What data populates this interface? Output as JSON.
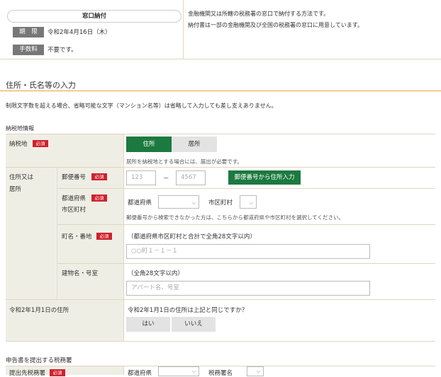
{
  "payment": {
    "method_label": "窓口納付",
    "deadline_tag": "期　限",
    "deadline_value": "令和2年4月16日（木）",
    "fee_tag": "手数料",
    "fee_value": "不要です。",
    "desc_line1": "金融機関又は所轄の税務署の窓口で納付する方法です。",
    "desc_line2": "納付書は一部の金融機関及び全国の税務署の窓口に用意しています。"
  },
  "section": {
    "title": "住所・氏名等の入力",
    "note": "制限文字数を超える場合、省略可能な文字（マンション名等）は省略して入力しても差し支えありません。",
    "subsection": "納税地情報"
  },
  "required_label": "必須",
  "form": {
    "nozeichi_label": "納税地",
    "tab_address": "住所",
    "tab_residence": "居所",
    "tab_note": "居所を納税地とする場合には、届出が必要です。",
    "address_label_line1": "住所又は",
    "address_label_line2": "居所",
    "postal_label": "郵便番号",
    "postal_part1_placeholder": "123",
    "postal_dash": "－",
    "postal_part2_placeholder": "4567",
    "postal_lookup_button": "郵便番号から住所入力",
    "pref_label_line1": "都道府県",
    "pref_label_line2": "市区町村",
    "pref_select_label": "都道府県",
    "city_select_label": "市区町村",
    "pref_note": "郵便番号から検索できなかった方は、こちらから都道府県や市区町村を選択してください。",
    "street_label": "町名・番地",
    "street_hint": "（都道府県市区町村と合計で全角28文字以内）",
    "street_placeholder": "○○町１－１－１",
    "building_label": "建物名・号室",
    "building_hint": "（全角28文字以内）",
    "building_placeholder": "アパート名、号室",
    "jan1_label": "令和2年1月1日の住所",
    "jan1_question": "令和2年1月1日の住所は上記と同じですか？",
    "yes_button": "はい",
    "no_button": "いいえ"
  },
  "office_section": {
    "title": "申告書を提出する税務署",
    "office_label": "提出先税務署",
    "pref_select_label": "都道府県",
    "office_select_label": "税務署名"
  }
}
